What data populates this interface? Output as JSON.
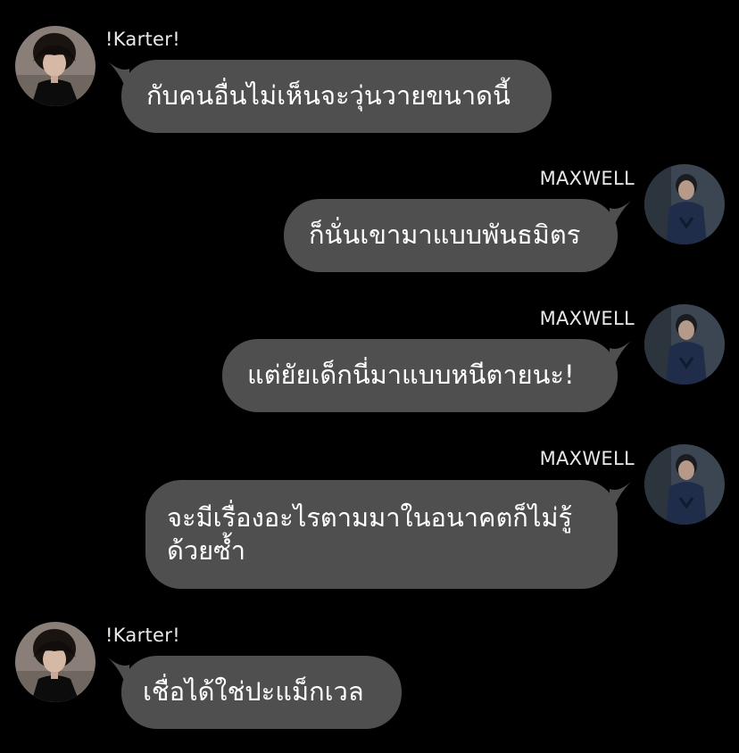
{
  "messages": [
    {
      "sender": "!Karter!",
      "side": "left",
      "text": "กับคนอื่นไม่เห็นจะวุ่นวายขนาดนี้"
    },
    {
      "sender": "MAXWELL",
      "side": "right",
      "text": "ก็นั่นเขามาแบบพันธมิตร"
    },
    {
      "sender": "MAXWELL",
      "side": "right",
      "text": "แต่ยัยเด็กนี่มาแบบหนีตายนะ!"
    },
    {
      "sender": "MAXWELL",
      "side": "right",
      "text_line1": "จะมีเรื่องอะไรตามมาในอนาคตก็ไม่รู้",
      "text_line2": "ด้วยซ้ำ"
    },
    {
      "sender": "!Karter!",
      "side": "left",
      "text": "เชื่อได้ใช่ปะแม็กเวล"
    }
  ],
  "colors": {
    "background": "#000000",
    "bubble": "#4f4f4f",
    "text": "#ffffff",
    "name": "#e9e9e9"
  },
  "icons": [
    "karter-avatar-icon",
    "maxwell-avatar-icon"
  ]
}
